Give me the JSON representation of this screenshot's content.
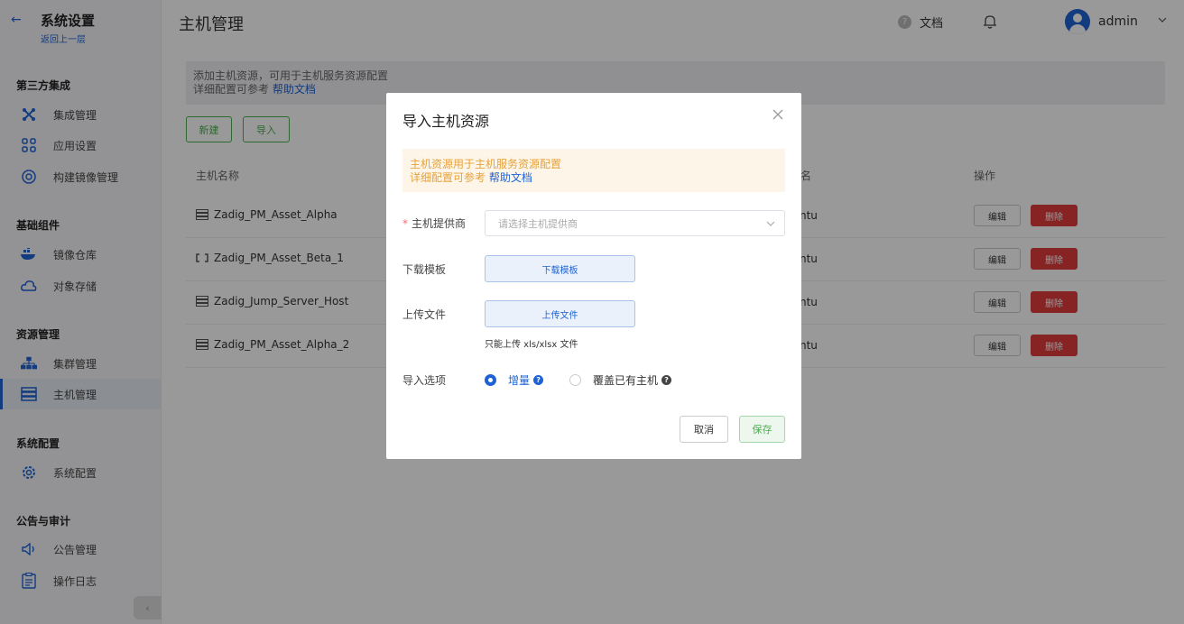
{
  "sidebar": {
    "back_icon": "arrow-left-icon",
    "title": "系统设置",
    "subtitle": "返回上一层",
    "groups": [
      {
        "label": "第三方集成",
        "items": [
          {
            "label": "集成管理",
            "icon": "integration-icon"
          },
          {
            "label": "应用设置",
            "icon": "apps-icon"
          },
          {
            "label": "构建镜像管理",
            "icon": "build-image-icon"
          }
        ]
      },
      {
        "label": "基础组件",
        "items": [
          {
            "label": "镜像仓库",
            "icon": "docker-icon"
          },
          {
            "label": "对象存储",
            "icon": "cloud-icon"
          }
        ]
      },
      {
        "label": "资源管理",
        "items": [
          {
            "label": "集群管理",
            "icon": "cluster-icon"
          },
          {
            "label": "主机管理",
            "icon": "server-icon",
            "active": true
          }
        ]
      },
      {
        "label": "系统配置",
        "items": [
          {
            "label": "系统配置",
            "icon": "settings-gear-icon"
          }
        ]
      },
      {
        "label": "公告与审计",
        "items": [
          {
            "label": "公告管理",
            "icon": "announcement-icon"
          },
          {
            "label": "操作日志",
            "icon": "clipboard-icon"
          }
        ]
      }
    ],
    "collapse_label": "‹"
  },
  "header": {
    "title": "主机管理",
    "doc_label": "文档",
    "doc_icon": "question-icon",
    "bell_icon": "bell-icon",
    "username": "admin"
  },
  "info": {
    "line1": "添加主机资源，可用于主机服务资源配置",
    "line2_prefix": "详细配置可参考",
    "line2_link": "帮助文档"
  },
  "toolbar": {
    "new_label": "新建",
    "import_label": "导入"
  },
  "table": {
    "col_name": "主机名称",
    "col_os_fragment": "名",
    "col_actions": "操作",
    "rows": [
      {
        "name": "Zadig_PM_Asset_Alpha",
        "icon": "server-icon",
        "os": "ntu",
        "edit": "编辑",
        "delete": "删除"
      },
      {
        "name": "Zadig_PM_Asset_Beta_1",
        "icon": "link-icon",
        "os": "ntu",
        "edit": "编辑",
        "delete": "删除"
      },
      {
        "name": "Zadig_Jump_Server_Host",
        "icon": "server-icon",
        "os": "ntu",
        "edit": "编辑",
        "delete": "删除"
      },
      {
        "name": "Zadig_PM_Asset_Alpha_2",
        "icon": "server-icon",
        "os": "ntu",
        "edit": "编辑",
        "delete": "删除"
      }
    ]
  },
  "dialog": {
    "title": "导入主机资源",
    "close_icon": "close-icon",
    "alert_line1": "主机资源用于主机服务资源配置",
    "alert_line2_prefix": "详细配置可参考",
    "alert_line2_link": "帮助文档",
    "provider_label": "主机提供商",
    "provider_placeholder": "请选择主机提供商",
    "download_label": "下载模板",
    "download_button": "下载模板",
    "upload_label": "上传文件",
    "upload_button": "上传文件",
    "upload_hint": "只能上传 xls/xlsx 文件",
    "import_option_label": "导入选项",
    "option_increment": "增量",
    "option_overwrite": "覆盖已有主机",
    "cancel": "取消",
    "save": "保存"
  },
  "colors": {
    "accent": "#1e63d6",
    "success": "#4caf50",
    "danger": "#e03c3c",
    "warning": "#e6a23c"
  }
}
